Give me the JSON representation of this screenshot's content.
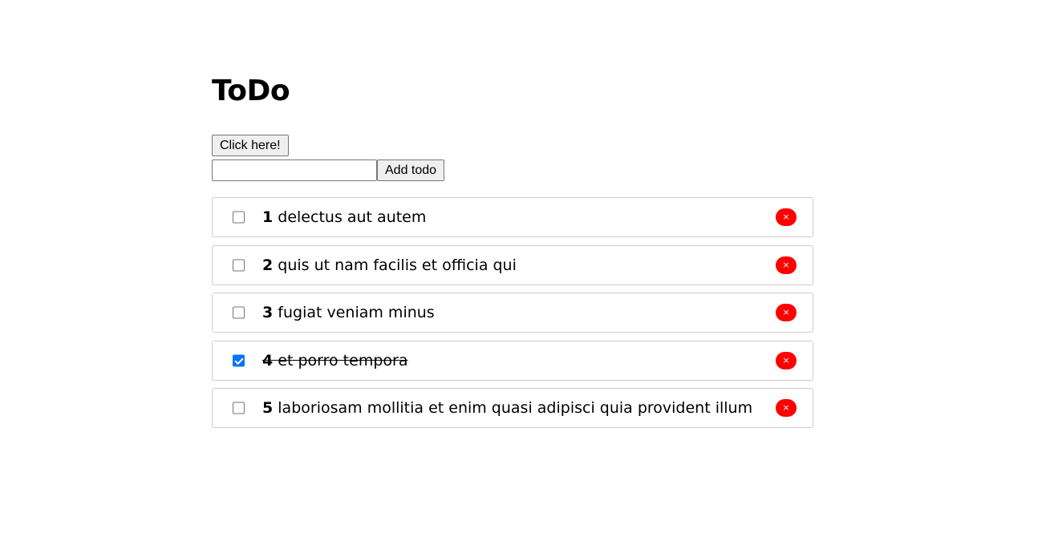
{
  "page": {
    "title": "ToDo"
  },
  "controls": {
    "click_button_label": "Click here!",
    "input_value": "",
    "input_placeholder": "",
    "add_button_label": "Add todo"
  },
  "todos": [
    {
      "id": "1",
      "text": "delectus aut autem",
      "completed": false,
      "delete_glyph": "×"
    },
    {
      "id": "2",
      "text": "quis ut nam facilis et officia qui",
      "completed": false,
      "delete_glyph": "×"
    },
    {
      "id": "3",
      "text": "fugiat veniam minus",
      "completed": false,
      "delete_glyph": "×"
    },
    {
      "id": "4",
      "text": "et porro tempora",
      "completed": true,
      "delete_glyph": "×"
    },
    {
      "id": "5",
      "text": "laboriosam mollitia et enim quasi adipisci quia provident illum",
      "completed": false,
      "delete_glyph": "×"
    }
  ],
  "colors": {
    "delete_button": "#ff0000",
    "checkbox_checked": "#0075ff",
    "item_border": "#cccccc"
  }
}
